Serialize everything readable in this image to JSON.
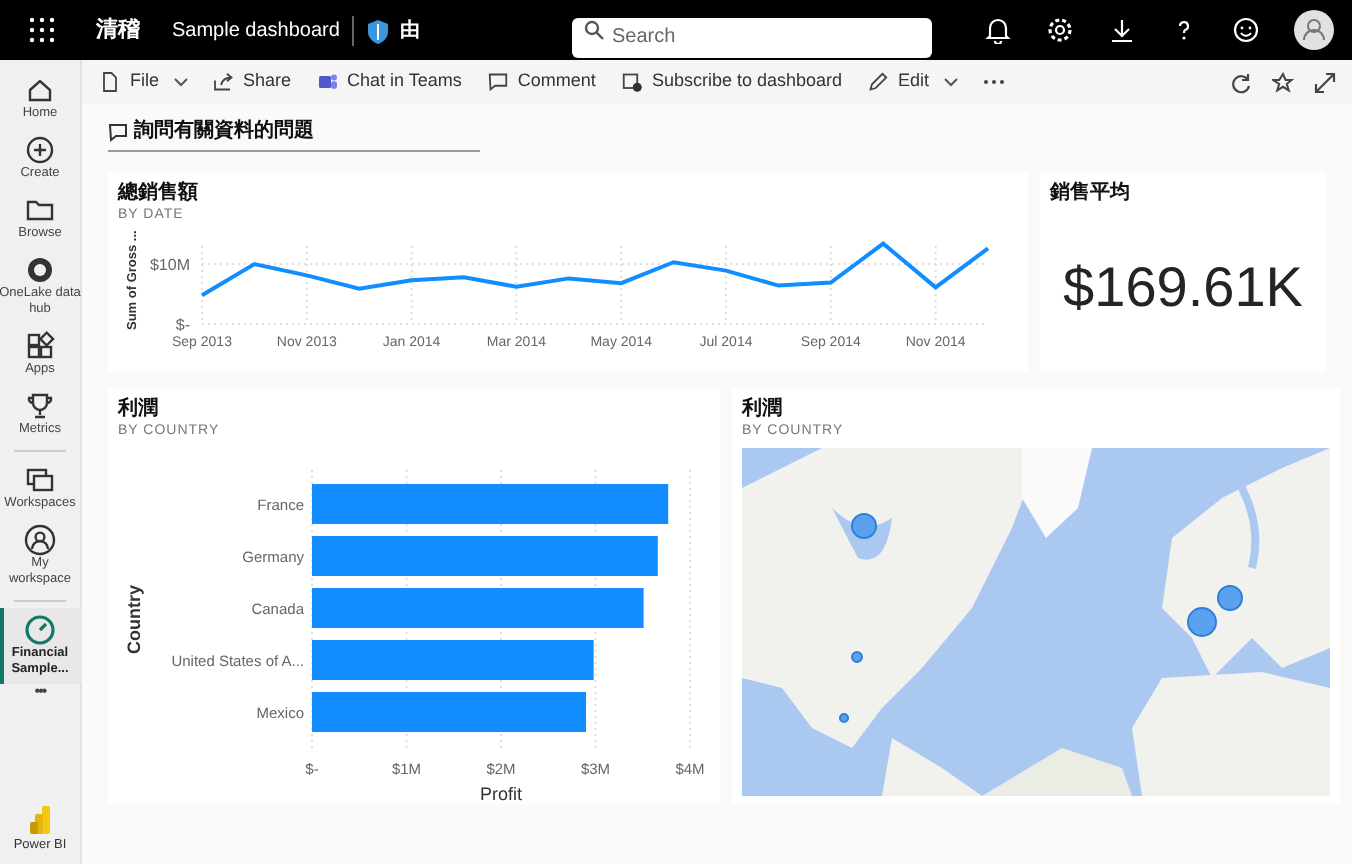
{
  "topbar": {
    "app_title": "清稽",
    "report_title": "Sample dashboard",
    "sensitivity": "由",
    "search": {
      "placeholder": "Search"
    }
  },
  "sidebar": {
    "items": [
      {
        "label": "Home",
        "selected": false
      },
      {
        "label": "Create",
        "selected": false
      },
      {
        "label": "Browse",
        "selected": false
      },
      {
        "label": "OneLake data hub",
        "selected": false
      },
      {
        "label": "Apps",
        "selected": false
      },
      {
        "label": "Metrics",
        "selected": false
      },
      {
        "label": "Workspaces",
        "selected": false
      },
      {
        "label": "My workspace",
        "selected": false
      },
      {
        "label": "Financial Sample...",
        "selected": true
      }
    ],
    "more": "•••",
    "footer": "Power BI"
  },
  "toolbar": {
    "items": [
      {
        "label": "File",
        "dropdown": true
      },
      {
        "label": "Share",
        "dropdown": false
      },
      {
        "label": "Chat in Teams",
        "dropdown": false
      },
      {
        "label": "Comment",
        "dropdown": false
      },
      {
        "label": "Subscribe to dashboard",
        "dropdown": false
      },
      {
        "label": "Edit",
        "dropdown": true
      }
    ]
  },
  "qa": {
    "placeholder": "詢問有關資料的問題"
  },
  "tiles": [
    {
      "kind": "line",
      "title": "總銷售額",
      "subtitle": "BY DATE",
      "axis_title": "Sum of Gross ...",
      "y_labels": [
        "$10M",
        "$-"
      ],
      "x_labels": [
        "Sep 2013",
        "Nov 2013",
        "Jan 2014",
        "Mar 2014",
        "May 2014",
        "Jul 2014",
        "Sep 2014",
        "Nov 2014"
      ]
    },
    {
      "kind": "card",
      "title": "銷售平均",
      "value": "$169.61K"
    },
    {
      "kind": "bar",
      "title": "利潤",
      "subtitle": "BY COUNTRY",
      "chart_data": {
        "type": "bar",
        "orientation": "horizontal",
        "xlabel": "Profit",
        "ylabel": "Country",
        "categories": [
          "France",
          "Germany",
          "Canada",
          "United States of A...",
          "Mexico"
        ],
        "series": [
          {
            "color": "#118dff",
            "values": [
              3.77,
              3.66,
              3.51,
              2.98,
              2.9
            ]
          }
        ],
        "xlim": [
          0,
          4
        ],
        "xticks": [
          {
            "value": 0,
            "label": "$-"
          },
          {
            "value": 1,
            "label": "$1M"
          },
          {
            "value": 2,
            "label": "$2M"
          },
          {
            "value": 3,
            "label": "$3M"
          },
          {
            "value": 4,
            "label": "$4M"
          }
        ],
        "grid": true
      }
    },
    {
      "kind": "map",
      "title": "利潤",
      "subtitle": "BY COUNTRY"
    }
  ]
}
